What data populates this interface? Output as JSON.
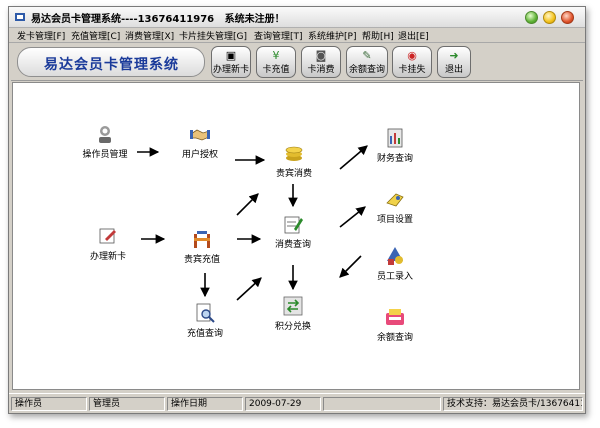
{
  "window": {
    "title": "易达会员卡管理系统----13676411976   系统未注册！"
  },
  "menu": [
    {
      "label": "发卡管理[F]"
    },
    {
      "label": "充值管理[C]"
    },
    {
      "label": "消费管理[X]"
    },
    {
      "label": "卡片挂失管理[G]"
    },
    {
      "label": "查询管理[T]"
    },
    {
      "label": "系统维护[P]"
    },
    {
      "label": "帮助[H]"
    },
    {
      "label": "退出[E]"
    }
  ],
  "toolbar": {
    "banner": "易达会员卡管理系统",
    "buttons": [
      {
        "label": "办理新卡",
        "icon": "card-icon"
      },
      {
        "label": "卡充值",
        "icon": "yen-icon"
      },
      {
        "label": "卡消费",
        "icon": "wallet-icon"
      },
      {
        "label": "余额查询",
        "icon": "search-doc-icon"
      },
      {
        "label": "卡挂失",
        "icon": "lock-icon"
      },
      {
        "label": "退出",
        "icon": "exit-icon"
      }
    ]
  },
  "workflow": {
    "operator_mgmt": "操作员管理",
    "user_auth": "用户授权",
    "guest_spending": "贵宾消费",
    "finance_query": "财务查询",
    "project_settings": "项目设置",
    "new_card": "办理新卡",
    "guest_recharge": "贵宾充值",
    "spending_query": "消费查询",
    "employee_entry": "员工录入",
    "recharge_query": "充值查询",
    "points_exchange": "积分兑换",
    "balance_query": "余额查询"
  },
  "status": {
    "operator_label": "操作员",
    "operator_value": "管理员",
    "date_label": "操作日期",
    "date_value": "2009-07-29",
    "support": "技术支持：易达会员卡/13676411976"
  }
}
